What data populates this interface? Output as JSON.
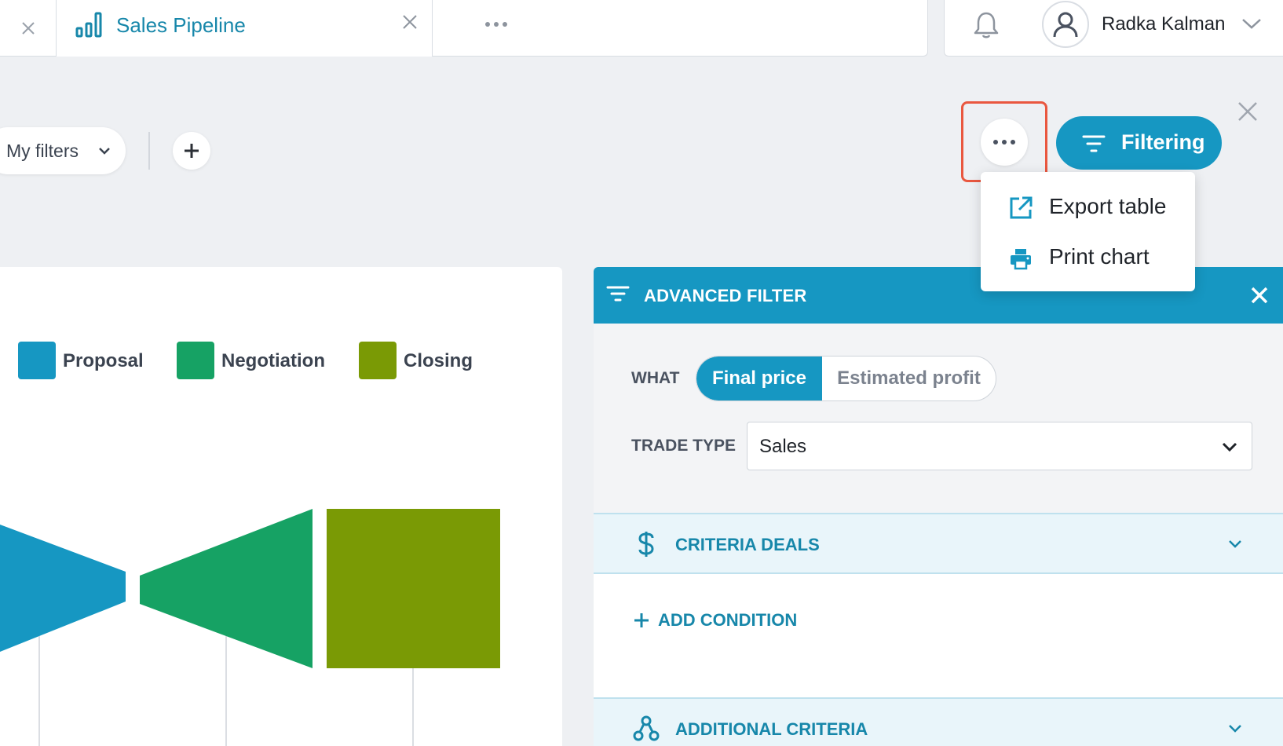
{
  "tabs": {
    "active_title": "Sales Pipeline"
  },
  "user": {
    "name": "Radka Kalman"
  },
  "toolbar": {
    "my_filters_label": "My filters",
    "filtering_label": "Filtering"
  },
  "menu": {
    "items": [
      {
        "label": "Export table",
        "icon": "external-link-icon"
      },
      {
        "label": "Print chart",
        "icon": "printer-icon"
      }
    ]
  },
  "chart_data": {
    "type": "funnel",
    "legend_position": "top",
    "series": [
      {
        "name": "Proposal",
        "color": "#1697c2"
      },
      {
        "name": "Negotiation",
        "color": "#16a264"
      },
      {
        "name": "Closing",
        "color": "#7a9a05"
      }
    ]
  },
  "advanced_filter": {
    "title": "ADVANCED FILTER",
    "what_label": "WHAT",
    "what_options": [
      "Final price",
      "Estimated profit"
    ],
    "what_selected": "Final price",
    "trade_type_label": "TRADE TYPE",
    "trade_type_value": "Sales",
    "sections": [
      {
        "title": "CRITERIA DEALS",
        "icon": "dollar-icon"
      },
      {
        "title": "ADDITIONAL CRITERIA",
        "icon": "network-icon"
      }
    ],
    "add_condition_label": "ADD CONDITION"
  },
  "colors": {
    "accent": "#1697c2",
    "highlight": "#e9573f"
  }
}
